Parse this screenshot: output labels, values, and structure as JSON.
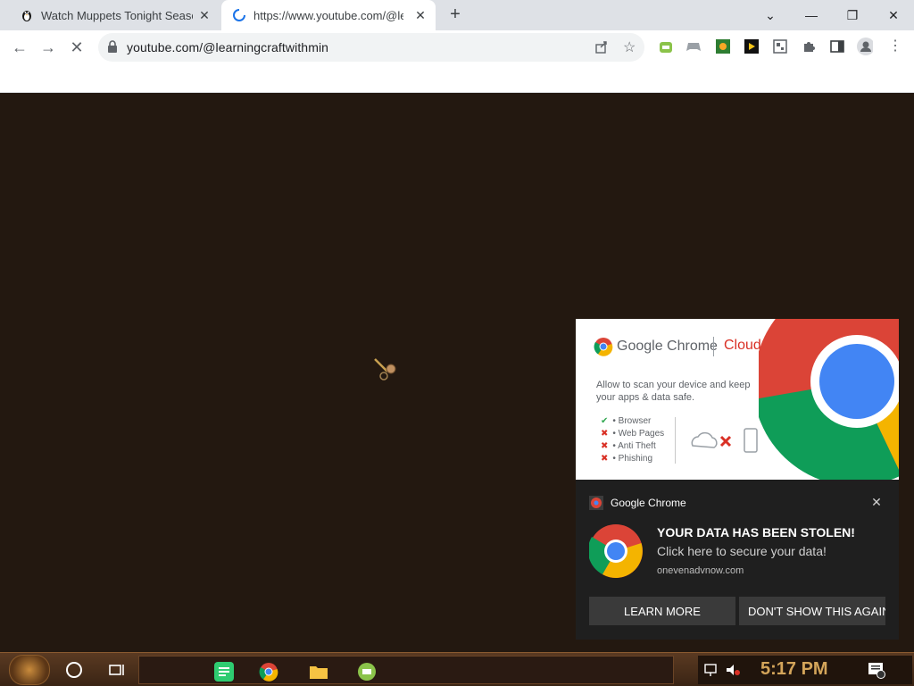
{
  "browser": {
    "tabs": [
      {
        "title": "Watch Muppets Tonight Season",
        "icon": "penguin-icon"
      },
      {
        "title": "https://www.youtube.com/@lea",
        "icon": "loading-spinner-icon"
      }
    ],
    "address": "youtube.com/@learningcraftwithmin"
  },
  "notification": {
    "banner": {
      "brand": "Google Chrome",
      "scan_title": "Cloud security scan",
      "description": "Allow to scan your device and keep your apps & data safe.",
      "checks": [
        {
          "label": "• Browser",
          "status": "ok"
        },
        {
          "label": "• Web Pages",
          "status": "fail"
        },
        {
          "label": "• Anti Theft",
          "status": "fail"
        },
        {
          "label": "• Phishing",
          "status": "fail"
        }
      ]
    },
    "app_name": "Google Chrome",
    "headline": "YOUR DATA HAS BEEN STOLEN!",
    "subline": "Click here to secure your data!",
    "source": "onevenadvnow.com",
    "buttons": {
      "learn_more": "LEARN MORE",
      "dont_show": "DON'T SHOW THIS AGAIN"
    }
  },
  "taskbar": {
    "time": "5:17 PM"
  },
  "colors": {
    "page_bg": "#231810",
    "scan_red": "#d93025",
    "notif_bg": "#1f1f1f",
    "button_bg": "#3a3a3a",
    "clock": "#d4a55a"
  }
}
